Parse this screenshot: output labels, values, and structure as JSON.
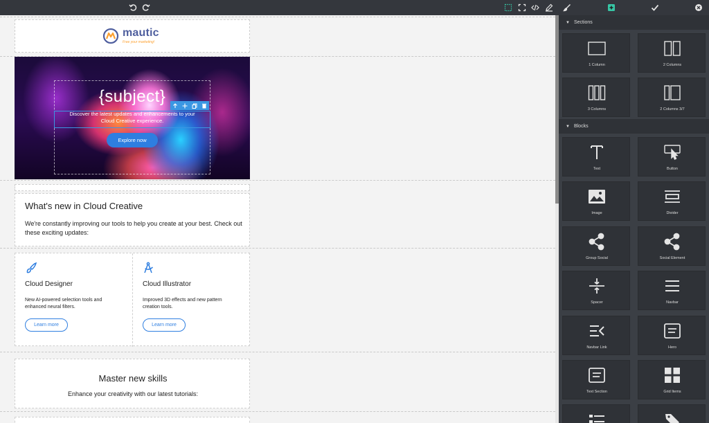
{
  "toolbar": {
    "undo": "undo-icon",
    "redo": "redo-icon",
    "buttons": [
      "sw-visibility-icon",
      "fullscreen-icon",
      "code-icon",
      "edit-icon",
      "style-manager-icon",
      "block-manager-icon",
      "settings-icon",
      "close-icon"
    ],
    "colors": {
      "background": "#34373d",
      "active": "#37c6a5"
    }
  },
  "logo": {
    "name": "mautic",
    "tagline": "Free your marketing!"
  },
  "hero": {
    "title": "{subject}",
    "description": "Discover the latest updates and enhancements to your Cloud Creative experience.",
    "button": "Explore now"
  },
  "whats_new": {
    "title": "What's new in Cloud Creative",
    "body": "We're constantly improving our tools to help you create at your best. Check out these exciting updates:"
  },
  "columns": [
    {
      "title": "Cloud Designer",
      "body": "New AI-powered selection tools and enhanced neural filters.",
      "button": "Learn more",
      "icon": "paintbrush-icon"
    },
    {
      "title": "Cloud Illustrator",
      "body": "Improved 3D effects and new pattern creation tools.",
      "button": "Learn more",
      "icon": "compass-pen-icon"
    }
  ],
  "skills": {
    "title": "Master new skills",
    "body": "Enhance your creativity with our latest tutorials:"
  },
  "panel": {
    "sections_title": "Sections",
    "blocks_title": "Blocks",
    "sections": [
      "1 Column",
      "2 Columns",
      "3 Columns",
      "2 Columns 3/7"
    ],
    "blocks": [
      "Text",
      "Button",
      "Image",
      "Divider",
      "Group Social",
      "Social Element",
      "Spacer",
      "Navbar",
      "Navbar Link",
      "Hero",
      "Text Section",
      "Grid Items"
    ]
  }
}
